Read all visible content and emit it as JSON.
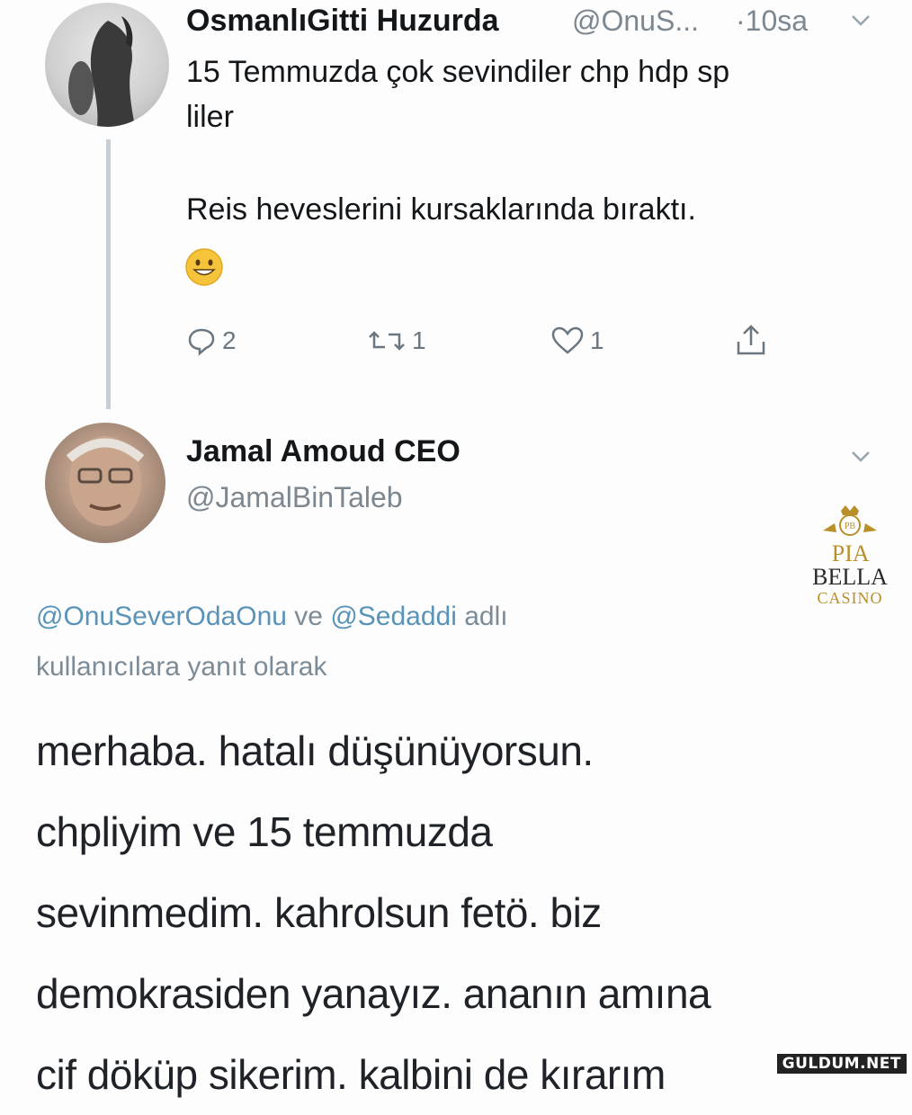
{
  "tweet1": {
    "author_name": "OsmanlıGitti Huzurda",
    "author_handle": "@OnuS...",
    "time": "·10sa",
    "text_line1": "15 Temmuzda çok sevindiler chp hdp sp",
    "text_line2": "liler",
    "text_line3": "Reis heveslerini kursaklarında bıraktı.",
    "emoji": "😀",
    "actions": {
      "reply_count": "2",
      "retweet_count": "1",
      "like_count": "1"
    }
  },
  "tweet2": {
    "author_name": "Jamal Amoud CEO",
    "author_handle": "@JamalBinTaleb",
    "reply_to": {
      "mention1": "@OnuSeverOdaOnu",
      "connector": "ve",
      "mention2": "@Sedaddi",
      "suffix": "adlı",
      "line2": "kullanıcılara yanıt olarak"
    },
    "body_lines": [
      "merhaba. hatalı düşünüyorsun.",
      "chpliyim ve 15 temmuzda",
      "sevinmedim. kahrolsun fetö. biz",
      "demokrasiden yanayız. ananın amına",
      "cif döküp sikerim. kalbini de kırarım"
    ]
  },
  "watermark": {
    "monogram": "PB",
    "brand_line1_a": "PIA",
    "brand_line1_b": "BELLA",
    "brand_line2": "CASINO",
    "site": "GULDUM.NET"
  },
  "colors": {
    "gold": "#b8902a",
    "mention_blue": "#5a93b8",
    "muted_gray": "#7c8790"
  }
}
